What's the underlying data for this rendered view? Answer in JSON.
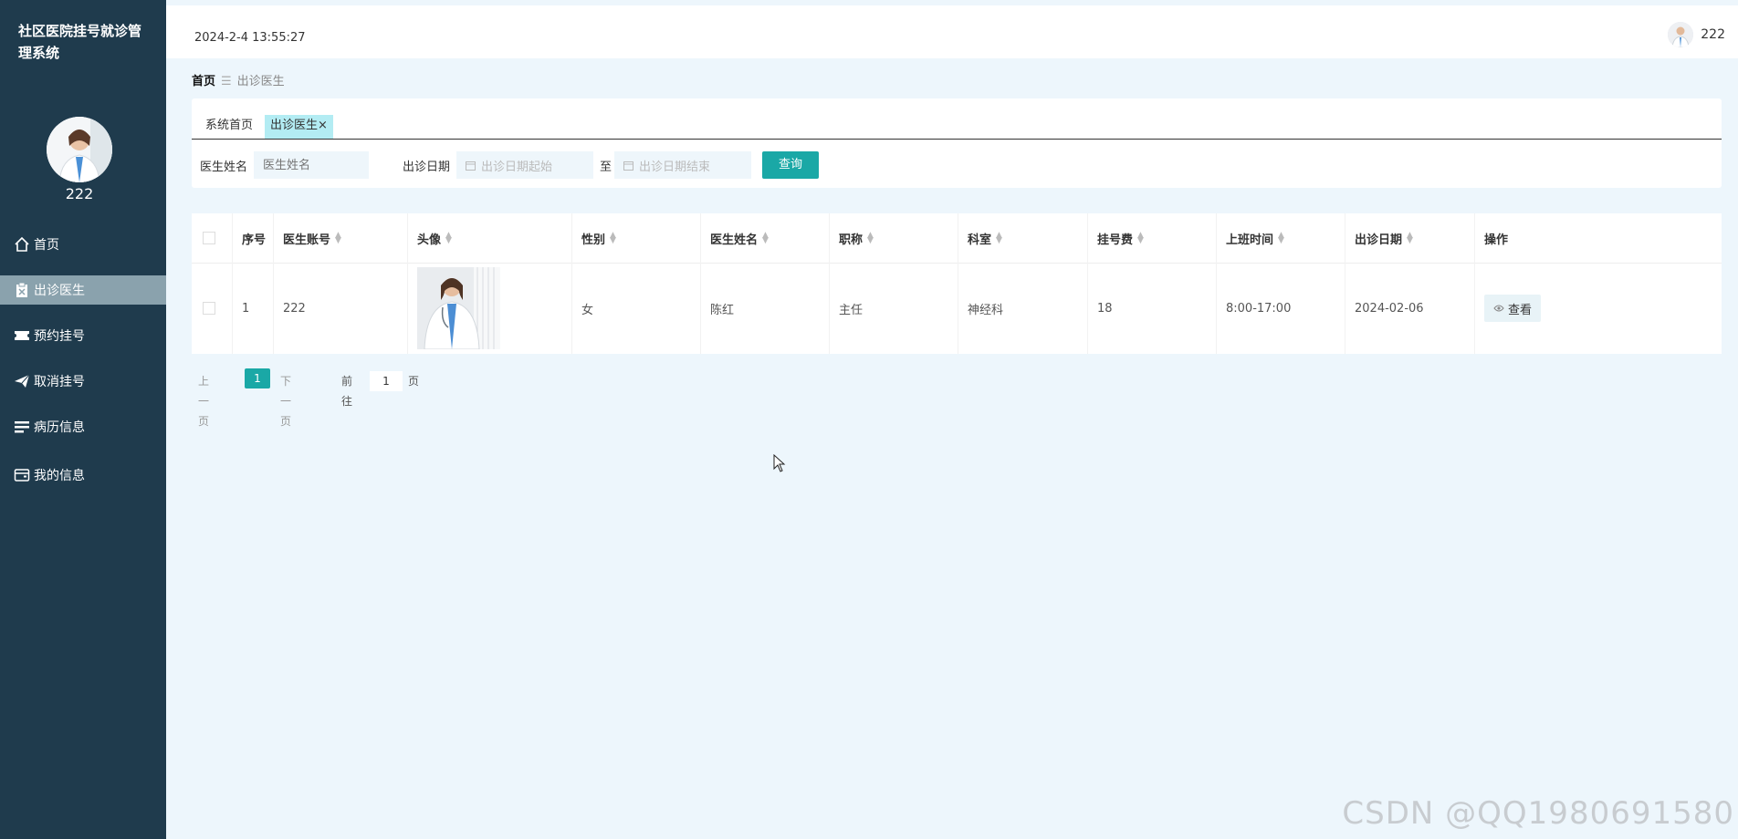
{
  "app": {
    "title": "社区医院挂号就诊管理系统"
  },
  "sidebar": {
    "username": "222",
    "items": [
      {
        "label": "首页",
        "icon": "home-icon"
      },
      {
        "label": "出诊医生",
        "icon": "clipboard-icon",
        "active": true
      },
      {
        "label": "预约挂号",
        "icon": "ticket-icon"
      },
      {
        "label": "取消挂号",
        "icon": "send-icon"
      },
      {
        "label": "病历信息",
        "icon": "list-icon"
      },
      {
        "label": "我的信息",
        "icon": "wallet-icon"
      }
    ]
  },
  "header": {
    "datetime": "2024-2-4 13:55:27",
    "username": "222"
  },
  "breadcrumb": {
    "home": "首页",
    "separator": "☰",
    "current": "出诊医生"
  },
  "tabs": [
    {
      "label": "系统首页"
    },
    {
      "label": "出诊医生",
      "close": "×",
      "active": true
    }
  ],
  "filters": {
    "doctor_name_label": "医生姓名",
    "doctor_name_placeholder": "医生姓名",
    "date_label": "出诊日期",
    "date_start_placeholder": "出诊日期起始",
    "date_to": "至",
    "date_end_placeholder": "出诊日期结束",
    "query_label": "查询"
  },
  "table": {
    "columns": [
      "序号",
      "医生账号",
      "头像",
      "性别",
      "医生姓名",
      "职称",
      "科室",
      "挂号费",
      "上班时间",
      "出诊日期",
      "操作"
    ],
    "rows": [
      {
        "index": "1",
        "account": "222",
        "gender": "女",
        "name": "陈红",
        "title": "主任",
        "department": "神经科",
        "fee": "18",
        "hours": "8:00-17:00",
        "date": "2024-02-06",
        "action": "查看"
      }
    ]
  },
  "pagination": {
    "prev": "上一页",
    "current": "1",
    "next": "下一页",
    "goto": "前往",
    "page_input": "1",
    "page_suffix": "页"
  },
  "watermark": "CSDN @QQ1980691580",
  "colors": {
    "sidebar_bg": "#1f3b4d",
    "accent": "#1aa8a6",
    "page_bg": "#edf6fc",
    "active_tab": "#b3ecf3"
  }
}
